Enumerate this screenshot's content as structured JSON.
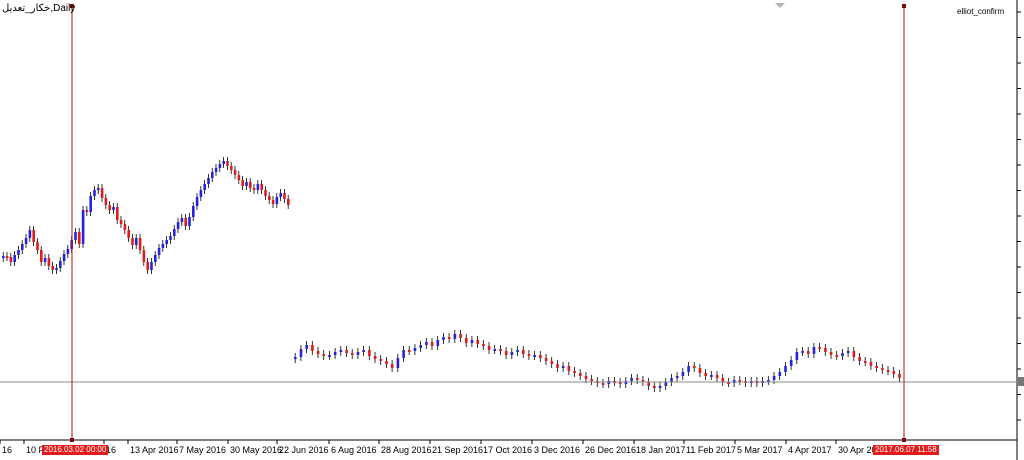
{
  "window": {
    "symbol_title": "خكار_تعديل,Daily",
    "indicator_name": "elliot_confirm"
  },
  "colors": {
    "up_candle": "#2424e0",
    "down_candle": "#e01b1b",
    "wick": "#000000",
    "vline": "#c21212",
    "hline": "#8a8a8a",
    "tag_bg": "#e31b1b"
  },
  "markers": {
    "left_label": "2016.03.02 00:00",
    "right_label": "2017.06.07 11:58"
  },
  "x_axis": {
    "labels": [
      "16",
      "10 F",
      "16",
      "13 Apr 2016",
      "7 May 2016",
      "30 May 2016",
      "22 Jun 2016",
      "6 Aug 2016",
      "28 Aug 2016",
      "21 Sep 2016",
      "17 Oct 2016",
      "3 Dec 2016",
      "26 Dec 2016",
      "18 Jan 2017",
      "11 Feb 2017",
      "5 Mar 2017",
      "4 Apr 2017",
      "30 Apr 201"
    ]
  },
  "chart_data": {
    "type": "candlestick",
    "segments": [
      {
        "name": "",
        "values": [
          256,
          257,
          262,
          255,
          250,
          244,
          238,
          230,
          242,
          250,
          262,
          258,
          266,
          270,
          268,
          261,
          254,
          249,
          240,
          232,
          244,
          210,
          212,
          196,
          190,
          188,
          198,
          205,
          210,
          207,
          220,
          224,
          230,
          238,
          245,
          238,
          250,
          262,
          270,
          262,
          255,
          248,
          244,
          240,
          236,
          229,
          222,
          218,
          226,
          217,
          206,
          197,
          190,
          184,
          178,
          172,
          168,
          164,
          161,
          166,
          170,
          175,
          180,
          186,
          182,
          188,
          190,
          184,
          190,
          196,
          200,
          204,
          197,
          193,
          199,
          205
        ]
      },
      {
        "name": "",
        "values": [
          357,
          349,
          345,
          351,
          354,
          356,
          355,
          352,
          350,
          353,
          355,
          352,
          350,
          356,
          359,
          361,
          364,
          368,
          358,
          350,
          351,
          348,
          345,
          342,
          346,
          340,
          337,
          339,
          334,
          338,
          343,
          340,
          344,
          346,
          350,
          349,
          351,
          355,
          352,
          350,
          354,
          356,
          355,
          358,
          361,
          364,
          368,
          366,
          371,
          373,
          376,
          379,
          381,
          383,
          384,
          381,
          382,
          384,
          381,
          378,
          380,
          382,
          386,
          388,
          386,
          382,
          378,
          376,
          372,
          366,
          368,
          373,
          376,
          375,
          378,
          382,
          383,
          380,
          381,
          383,
          381,
          383,
          381,
          380,
          376,
          372,
          366,
          360,
          352,
          351,
          354,
          347,
          348,
          352,
          355,
          356,
          353,
          351,
          357,
          361,
          362,
          366,
          368,
          370,
          371,
          374,
          378
        ]
      }
    ]
  }
}
